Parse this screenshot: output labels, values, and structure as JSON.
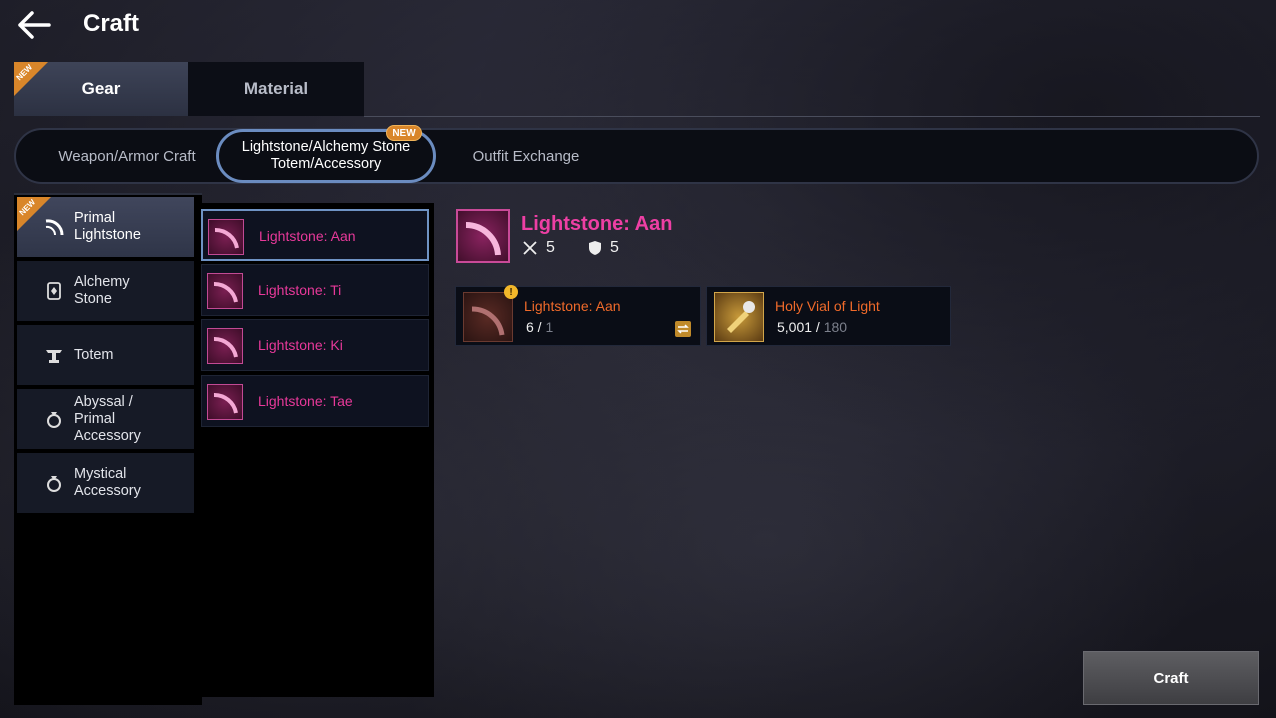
{
  "header": {
    "title": "Craft"
  },
  "main_tabs": [
    {
      "label": "Gear",
      "active": true,
      "new_badge": "NEW"
    },
    {
      "label": "Material",
      "active": false
    }
  ],
  "sub_tabs": [
    {
      "label": "Weapon/Armor Craft"
    },
    {
      "label_line1": "Lightstone/Alchemy Stone",
      "label_line2": "Totem/Accessory",
      "new_badge": "NEW",
      "active": true
    },
    {
      "label": "Outfit Exchange"
    }
  ],
  "categories": [
    {
      "line1": "Primal",
      "line2": "Lightstone",
      "icon": "arc-icon",
      "active": true,
      "new_badge": "NEW"
    },
    {
      "line1": "Alchemy",
      "line2": "Stone",
      "icon": "stone-icon"
    },
    {
      "line1": "Totem",
      "icon": "totem-icon"
    },
    {
      "line1": "Abyssal /",
      "line2": "Primal",
      "line3": "Accessory",
      "icon": "ring-icon"
    },
    {
      "line1": "Mystical",
      "line2": "Accessory",
      "icon": "ring-icon"
    }
  ],
  "items": [
    {
      "name": "Lightstone: Aan",
      "active": true
    },
    {
      "name": "Lightstone: Ti"
    },
    {
      "name": "Lightstone: Ki"
    },
    {
      "name": "Lightstone: Tae"
    }
  ],
  "detail": {
    "name": "Lightstone: Aan",
    "attack": "5",
    "defense": "5"
  },
  "materials": [
    {
      "name": "Lightstone: Aan",
      "owned": "6",
      "required": "1",
      "alert": "!"
    },
    {
      "name": "Holy Vial of Light",
      "owned": "5,001",
      "required": "180"
    }
  ],
  "craft_button": "Craft",
  "colors": {
    "item_name": "#e8399a",
    "material_name": "#f06a2a",
    "new_badge": "#d9862a"
  }
}
